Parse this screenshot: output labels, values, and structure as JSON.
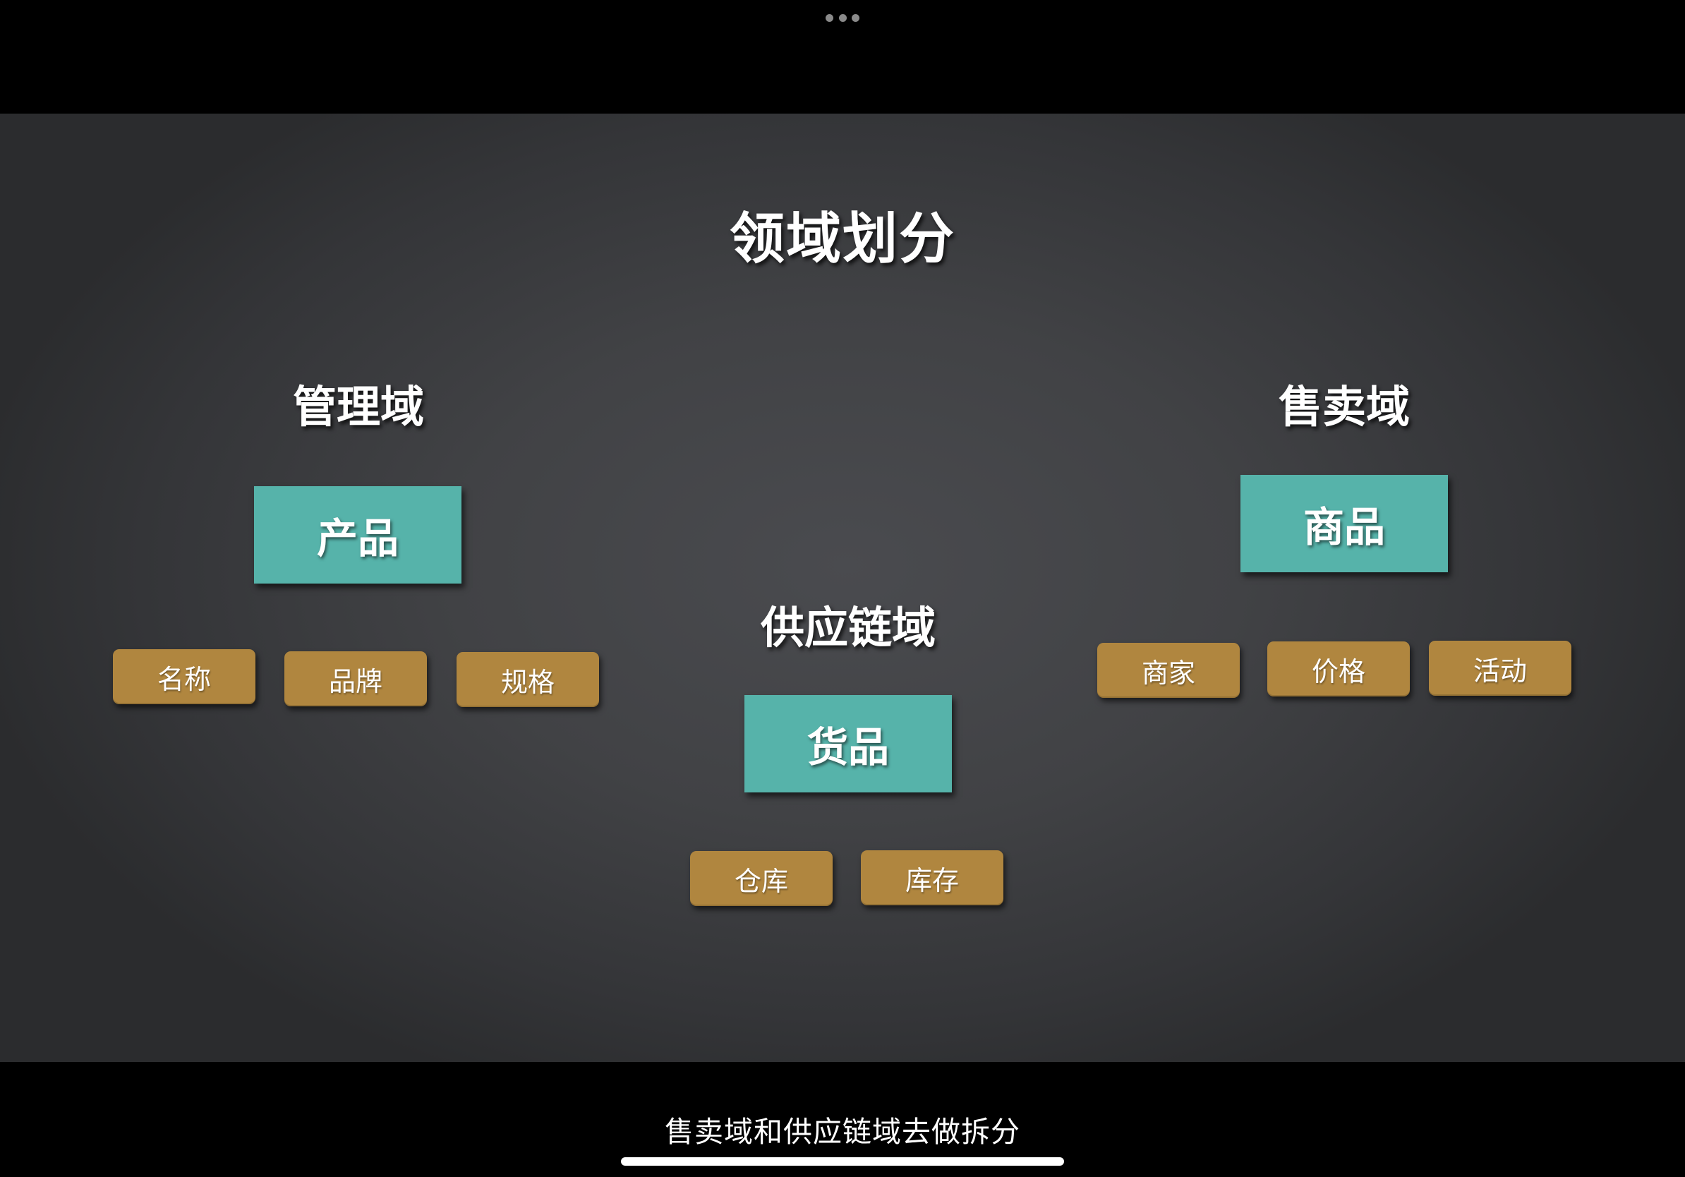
{
  "slide": {
    "title": "领域划分",
    "domains": {
      "management": {
        "label": "管理域",
        "entity": "产品",
        "attributes": [
          "名称",
          "品牌",
          "规格"
        ]
      },
      "supply_chain": {
        "label": "供应链域",
        "entity": "货品",
        "attributes": [
          "仓库",
          "库存"
        ]
      },
      "sales": {
        "label": "售卖域",
        "entity": "商品",
        "attributes": [
          "商家",
          "价格",
          "活动"
        ]
      }
    }
  },
  "caption": "售卖域和供应链域去做拆分",
  "colors": {
    "entity_box": "#56b3aa",
    "attribute_box": "#b0863f",
    "slide_background": "#414245"
  }
}
